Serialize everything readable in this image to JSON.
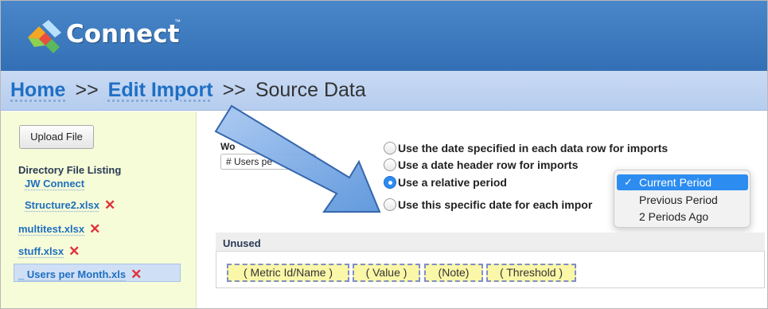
{
  "header": {
    "app_name": "Connect",
    "trademark": "™"
  },
  "breadcrumb": {
    "home": "Home",
    "sep1": ">>",
    "edit_import": "Edit Import",
    "sep2": ">>",
    "current": "Source Data"
  },
  "sidebar": {
    "upload_button": "Upload File",
    "directory_title": "Directory File Listing",
    "folder": "JW Connect",
    "files": [
      {
        "name": "Structure2.xlsx"
      },
      {
        "name": "multitest.xlsx"
      },
      {
        "name": "stuff.xlsx"
      },
      {
        "name": "_ Users per Month.xls"
      }
    ],
    "delete_symbol": "✕"
  },
  "worksheet": {
    "label": "Wo",
    "selected": "# Users pe"
  },
  "date_options": [
    {
      "label": "Use the date specified in each data row for imports",
      "selected": false
    },
    {
      "label": "Use a date header row for imports",
      "selected": false
    },
    {
      "label": "Use a relative period",
      "selected": true
    },
    {
      "label": "Use this specific date for each impor",
      "selected": false
    }
  ],
  "period_menu": {
    "items": [
      {
        "label": "Current Period",
        "selected": true
      },
      {
        "label": "Previous Period",
        "selected": false
      },
      {
        "label": "2 Periods Ago",
        "selected": false
      }
    ],
    "check": "✓"
  },
  "unused": {
    "title": "Unused",
    "fields": [
      {
        "label": "( Metric Id/Name )"
      },
      {
        "label": "( Value )"
      },
      {
        "label": "(Note)"
      },
      {
        "label": "( Threshold )"
      }
    ]
  },
  "colors": {
    "header_blue": "#3f7cc0",
    "link_blue": "#1f6fc4",
    "sidebar_bg": "#f6fbd8",
    "delete_red": "#e0303a",
    "chip_bg": "#fbf7a8",
    "selection_blue": "#2d8cf0"
  }
}
